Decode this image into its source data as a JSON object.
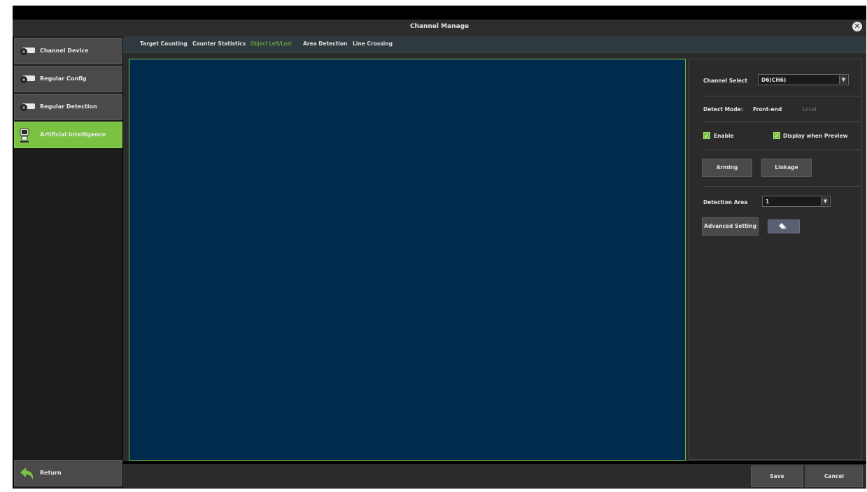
{
  "window": {
    "title": "Channel Manage"
  },
  "sidebar": {
    "items": [
      {
        "label": "Channel Device",
        "icon": "camera-icon",
        "active": false
      },
      {
        "label": "Regular Config",
        "icon": "camera-icon",
        "active": false
      },
      {
        "label": "Regular Detection",
        "icon": "camera-icon",
        "active": false
      },
      {
        "label": "Artificial Intelligence",
        "icon": "ai-robot-icon",
        "active": true
      }
    ],
    "return_label": "Return"
  },
  "tabs": [
    {
      "label": "Target Counting",
      "active": false
    },
    {
      "label": "Counter Statistics",
      "active": false
    },
    {
      "label": "Object Left/Lost",
      "active": true
    },
    {
      "label": "Area Detection",
      "active": false
    },
    {
      "label": "Line Crossing",
      "active": false
    }
  ],
  "panel": {
    "channel_select_label": "Channel Select",
    "channel_select_value": "D6(CH6)",
    "detect_mode_label": "Detect Mode:",
    "detect_mode_front": "Front-end",
    "detect_mode_local": "Local",
    "enable_label": "Enable",
    "enable_checked": true,
    "display_preview_label": "Display when Preview",
    "display_preview_checked": true,
    "arming_label": "Arming",
    "linkage_label": "Linkage",
    "detection_area_label": "Detection Area",
    "detection_area_value": "1",
    "advanced_setting_label": "Advanced Setting",
    "eraser_icon": "eraser-icon"
  },
  "footer": {
    "save_label": "Save",
    "cancel_label": "Cancel"
  },
  "colors": {
    "accent": "#7cc242",
    "video_bg": "#002b4d",
    "panel_bg": "#2b2b2b"
  }
}
